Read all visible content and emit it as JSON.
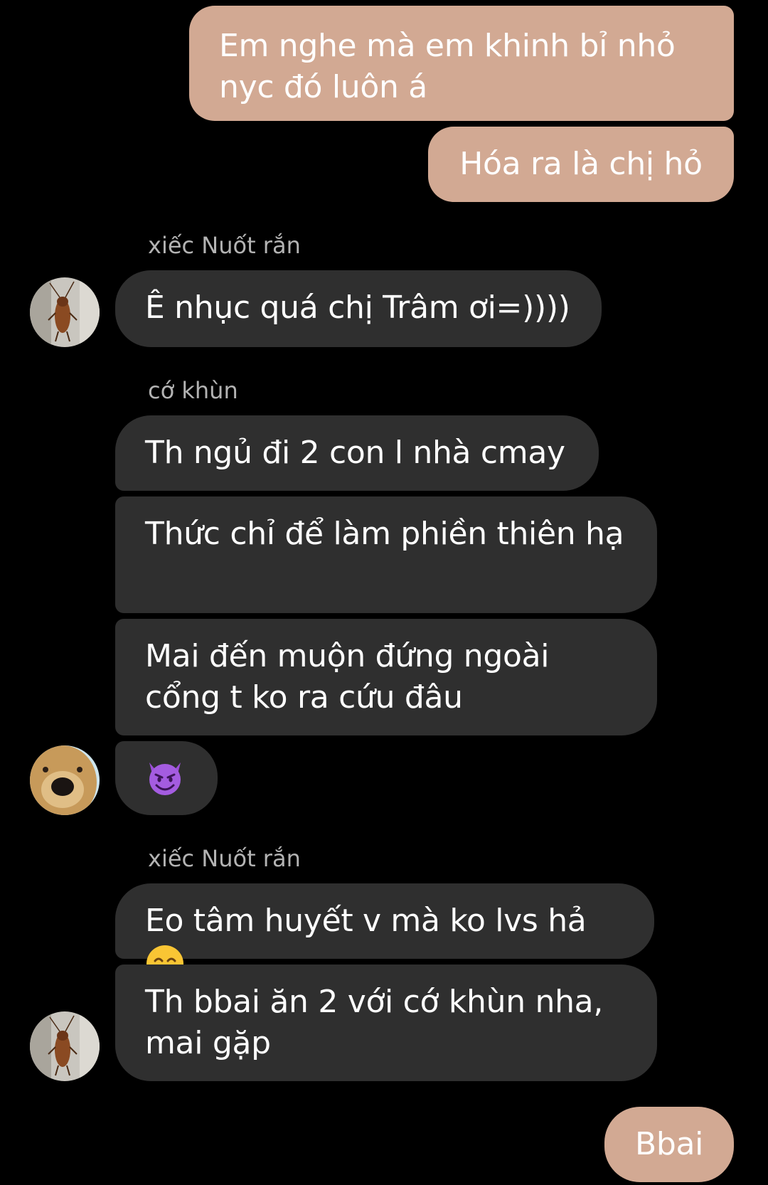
{
  "conversation": {
    "messages": [
      {
        "side": "out",
        "text": "Em nghe mà em khinh bỉ nhỏ nyc đó luôn á"
      },
      {
        "side": "out",
        "text": "Hóa ra là chị hỏ"
      },
      {
        "side": "in",
        "sender": "xiếc Nuốt rắn",
        "text": "Ê nhục quá chị Trâm ơi=))))"
      },
      {
        "side": "in",
        "sender": "cớ khùn",
        "text": "Th ngủ đi 2 con l nhà cmay"
      },
      {
        "side": "in",
        "text": "Thức chỉ để làm phiền thiên hạ"
      },
      {
        "side": "in",
        "text": "Mai đến muộn đứng ngoài cổng t ko ra cứu đâu"
      },
      {
        "side": "in",
        "emoji": "smiling-devil-emoji"
      },
      {
        "side": "in",
        "sender": "xiếc Nuốt rắn",
        "text": "Eo tâm huyết v mà ko lvs hả",
        "trailing_emoji": "smiling-face-emoji"
      },
      {
        "side": "in",
        "text": "Th bbai ăn 2 với cớ khùn nha, mai gặp"
      },
      {
        "side": "out",
        "text": "Bbai"
      }
    ]
  },
  "senders": {
    "xiec_nuot_ran": {
      "name": "xiếc Nuốt rắn",
      "avatar": "cockroach-avatar"
    },
    "co_khun": {
      "name": "cớ khùn",
      "avatar": "dog-avatar"
    }
  },
  "colors": {
    "background": "#000000",
    "outgoing_bubble": "#d2a993",
    "incoming_bubble": "#2f2f2f",
    "sender_name": "#b3b3b3",
    "text": "#ffffff"
  }
}
